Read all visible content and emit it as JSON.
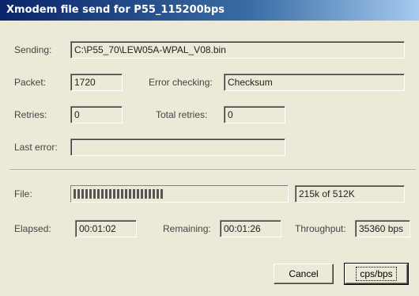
{
  "window": {
    "title": "Xmodem file send for P55_115200bps"
  },
  "sending": {
    "label": "Sending:",
    "value": "C:\\P55_70\\LEW05A-WPAL_V08.bin"
  },
  "packet": {
    "label": "Packet:",
    "value": "1720"
  },
  "error_checking": {
    "label": "Error checking:",
    "value": "Checksum"
  },
  "retries": {
    "label": "Retries:",
    "value": "0"
  },
  "total_retries": {
    "label": "Total retries:",
    "value": "0"
  },
  "last_error": {
    "label": "Last error:",
    "value": ""
  },
  "file": {
    "label": "File:",
    "progress_fraction": 0.42,
    "size_text": "215k of 512K"
  },
  "elapsed": {
    "label": "Elapsed:",
    "value": "00:01:02"
  },
  "remaining": {
    "label": "Remaining:",
    "value": "00:01:26"
  },
  "throughput": {
    "label": "Throughput:",
    "value": "35360 bps"
  },
  "buttons": {
    "cancel": "Cancel",
    "cps_bps": "cps/bps"
  }
}
